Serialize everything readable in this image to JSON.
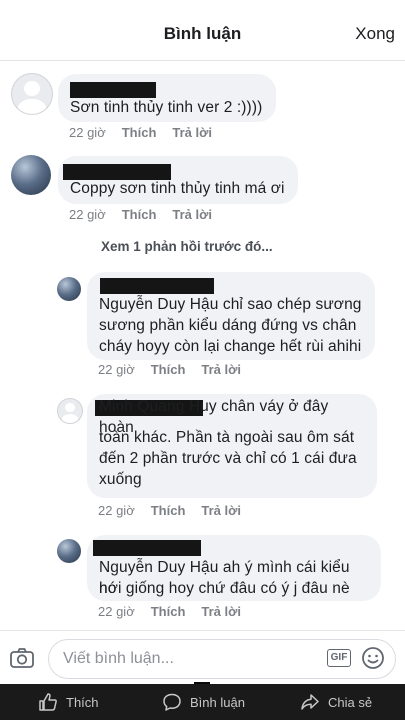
{
  "header": {
    "title": "Bình luận",
    "done_label": "Xong"
  },
  "comments": [
    {
      "text": "Sơn tinh thủy tinh ver 2 :))))",
      "time": "22 giờ",
      "like": "Thích",
      "reply": "Trả lời"
    },
    {
      "text": "Coppy sơn tinh thủy tinh má ơi",
      "time": "22 giờ",
      "like": "Thích",
      "reply": "Trả lời"
    }
  ],
  "view_more": "Xem 1 phản hồi trước đó...",
  "replies": [
    {
      "line1": "Nguyễn Duy Hậu chỉ sao chép sương",
      "line2": "sương phần kiểu dáng đứng vs chân",
      "line3": "cháy hoyy còn lại change hết rùi ahihi",
      "line4": "",
      "time": "22 giờ",
      "like": "Thích",
      "reply": "Trả lời"
    },
    {
      "line1": "Minh Quang Huy chân váy ở đây hoàn",
      "line2": "toàn khác. Phần tà ngoài sau ôm sát",
      "line3": "đến 2 phần trước và chỉ có 1 cái đưa",
      "line4": "xuống",
      "time": "22 giờ",
      "like": "Thích",
      "reply": "Trả lời"
    },
    {
      "line1": "Nguyễn Duy Hậu ah ý mình cái kiểu nó",
      "line2": "hơi giống hoy chứ đâu có ý j đâu nè",
      "line3": "",
      "line4": "",
      "time": "22 giờ",
      "like": "Thích",
      "reply": "Trả lời"
    }
  ],
  "composer": {
    "placeholder": "Viết bình luận...",
    "gif_label": "GIF"
  },
  "tabbar": {
    "like": "Thích",
    "comment": "Bình luận",
    "share": "Chia sẻ"
  },
  "icons": [
    "camera-icon",
    "gif-icon",
    "smiley-icon",
    "thumbs-up-icon",
    "comment-icon",
    "share-icon"
  ]
}
